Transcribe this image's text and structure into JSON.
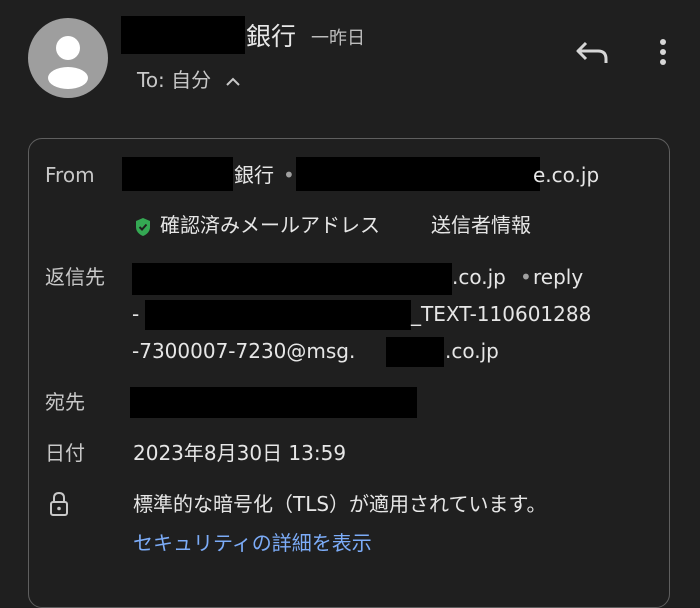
{
  "header": {
    "sender_name": "銀行",
    "time": "一昨日",
    "to_label": "To: 自分",
    "avatar_icon": "person-avatar-icon",
    "reply_icon": "reply-icon",
    "more_icon": "more-vert-icon"
  },
  "details": {
    "from": {
      "label": "From",
      "name_suffix": "銀行",
      "separator": "•",
      "email_tail": "e.co.jp"
    },
    "verified": {
      "text": "確認済みメールアドレス",
      "sender_info_link": "送信者情報",
      "icon": "verified-shield-icon",
      "color": "#34a853"
    },
    "reply_to": {
      "label": "返信先",
      "line1_tail": ".co.jp",
      "line1_reply": "reply",
      "line2_prefix": "-",
      "line2_tail": "_TEXT-110601288",
      "line3_prefix": "-7300007-7230@msg.",
      "line3_tail": ".co.jp"
    },
    "to": {
      "label": "宛先"
    },
    "date": {
      "label": "日付",
      "value": "2023年8月30日 13:59"
    },
    "security": {
      "icon": "lock-icon",
      "text": "標準的な暗号化（TLS）が適用されています。",
      "link": "セキュリティの詳細を表示",
      "link_color": "#7cacf8"
    }
  }
}
